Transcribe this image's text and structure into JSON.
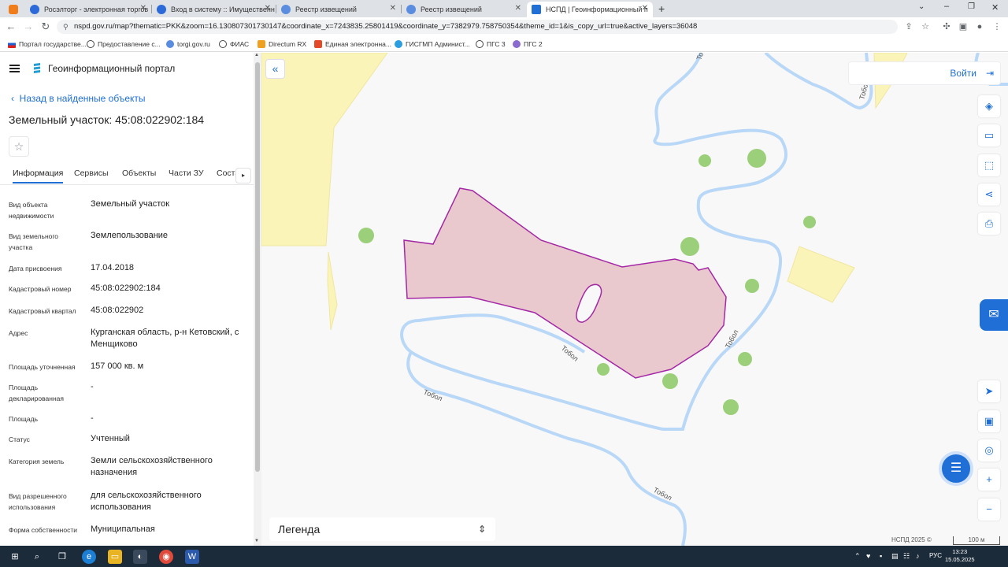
{
  "browser": {
    "tabs": [
      {
        "title": "Росэлторг - электронная торгов",
        "active": false
      },
      {
        "title": "Вход в систему :: Имущественн",
        "active": false
      },
      {
        "title": "Реестр извещений",
        "active": false
      },
      {
        "title": "Реестр извещений",
        "active": false
      },
      {
        "title": "НСПД | Геоинформационный п",
        "active": true
      }
    ],
    "new_tab": "+",
    "url": "nspd.gov.ru/map?thematic=PKK&zoom=16.130807301730147&coordinate_x=7243835.25801419&coordinate_y=7382979.758750354&theme_id=1&is_copy_url=true&active_layers=36048",
    "bookmarks": [
      "Портал государстве...",
      "Предоставление с...",
      "torgi.gov.ru",
      "ФИАС",
      "Directum RX",
      "Единая электронна...",
      "ГИСГМП Админист...",
      "ПГС 3",
      "ПГС 2"
    ]
  },
  "sidebar": {
    "portal_name": "Геоинформационный портал",
    "back_link": "Назад в найденные объекты",
    "title": "Земельный участок: 45:08:022902:184",
    "star_icon": "☆",
    "tabs": [
      "Информация",
      "Сервисы",
      "Объекты",
      "Части ЗУ",
      "Соста"
    ],
    "fields": [
      {
        "label": "Вид объекта недвижимости",
        "value": "Земельный участок"
      },
      {
        "label": "Вид земельного участка",
        "value": "Землепользование"
      },
      {
        "label": "Дата присвоения",
        "value": "17.04.2018"
      },
      {
        "label": "Кадастровый номер",
        "value": "45:08:022902:184"
      },
      {
        "label": "Кадастровый квартал",
        "value": "45:08:022902"
      },
      {
        "label": "Адрес",
        "value": "Курганская область, р-н Кетовский, с Менщиково"
      },
      {
        "label": "Площадь уточненная",
        "value": "157 000 кв. м"
      },
      {
        "label": "Площадь декларированная",
        "value": "-"
      },
      {
        "label": "Площадь",
        "value": "-"
      },
      {
        "label": "Статус",
        "value": "Учтенный"
      },
      {
        "label": "Категория земель",
        "value": "Земли сельскохозяйственного назначения"
      },
      {
        "label": "Вид разрешенного использования",
        "value": "для сельскохозяйственного использования"
      },
      {
        "label": "Форма собственности",
        "value": "Муниципальная"
      }
    ]
  },
  "map": {
    "login_label": "Войти",
    "legend_label": "Легенда",
    "river_name": "Тобол",
    "attribution": "НСПД 2025 ©",
    "scale_label": "100 м",
    "colors": {
      "parcel_fill": "#e9c9cd",
      "parcel_stroke": "#a428a6",
      "river": "#b9d8f7",
      "field": "#faf4b8",
      "tree": "#9ccf7a",
      "accent": "#1f6fd6"
    },
    "tools": [
      "layers-icon",
      "ruler-icon",
      "select-area-icon",
      "share-icon",
      "print-icon",
      "navigate-icon",
      "minimap-icon",
      "location-icon",
      "zoom-in-icon",
      "zoom-out-icon"
    ]
  },
  "taskbar": {
    "language": "РУС",
    "time": "13:23",
    "date": "15.05.2025"
  }
}
